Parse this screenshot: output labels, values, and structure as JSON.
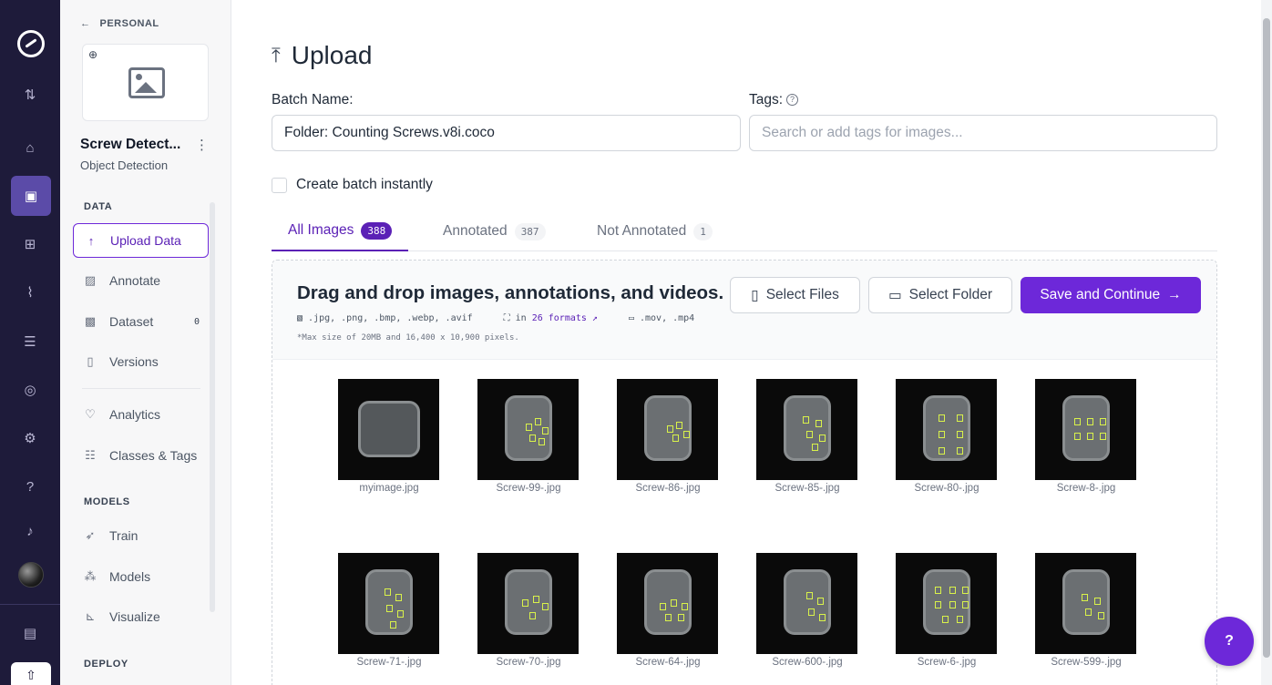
{
  "rail": {
    "icons": [
      "home-icon",
      "upload-data-icon",
      "workflows-icon",
      "analytics-icon",
      "deployments-icon",
      "universe-icon",
      "settings-icon",
      "help-icon",
      "notifications-icon"
    ]
  },
  "sidebar": {
    "back_label": "PERSONAL",
    "project_name": "Screw Detect...",
    "project_type": "Object Detection",
    "sections": {
      "data": "DATA",
      "models": "MODELS",
      "deploy": "DEPLOY"
    },
    "items": [
      {
        "label": "Upload Data",
        "icon": "upload-icon",
        "active": true
      },
      {
        "label": "Annotate",
        "icon": "annotate-icon"
      },
      {
        "label": "Dataset",
        "icon": "dataset-icon",
        "badge": "0"
      },
      {
        "label": "Versions",
        "icon": "versions-icon"
      },
      {
        "label": "Analytics",
        "icon": "analytics-icon"
      },
      {
        "label": "Classes & Tags",
        "icon": "classes-icon"
      },
      {
        "label": "Train",
        "icon": "train-icon"
      },
      {
        "label": "Models",
        "icon": "models-icon"
      },
      {
        "label": "Visualize",
        "icon": "visualize-icon"
      }
    ]
  },
  "main": {
    "title": "Upload",
    "batch_label": "Batch Name:",
    "batch_value": "Folder: Counting Screws.v8i.coco",
    "tags_label": "Tags:",
    "tags_placeholder": "Search or add tags for images...",
    "create_batch_label": "Create batch instantly",
    "tabs": [
      {
        "label": "All Images",
        "count": "388",
        "active": true
      },
      {
        "label": "Annotated",
        "count": "387"
      },
      {
        "label": "Not Annotated",
        "count": "1"
      }
    ],
    "drop": {
      "title": "Drag and drop images, annotations, and videos.",
      "image_formats": ".jpg, .png, .bmp, .webp, .avif",
      "annotation_prefix": "in",
      "annotation_link": "26 formats",
      "video_formats": ".mov, .mp4",
      "max_size": "*Max size of 20MB and 16,400 x 10,900 pixels."
    },
    "buttons": {
      "select_files": "Select Files",
      "select_folder": "Select Folder",
      "save_continue": "Save and Continue"
    },
    "images": [
      "myimage.jpg",
      "Screw-99-.jpg",
      "Screw-86-.jpg",
      "Screw-85-.jpg",
      "Screw-80-.jpg",
      "Screw-8-.jpg",
      "Screw-71-.jpg",
      "Screw-70-.jpg",
      "Screw-64-.jpg",
      "Screw-600-.jpg",
      "Screw-6-.jpg",
      "Screw-599-.jpg"
    ]
  },
  "colors": {
    "accent": "#6d28d9",
    "rail_bg": "#1e1b3a",
    "annotation_box": "#d9f24a"
  }
}
